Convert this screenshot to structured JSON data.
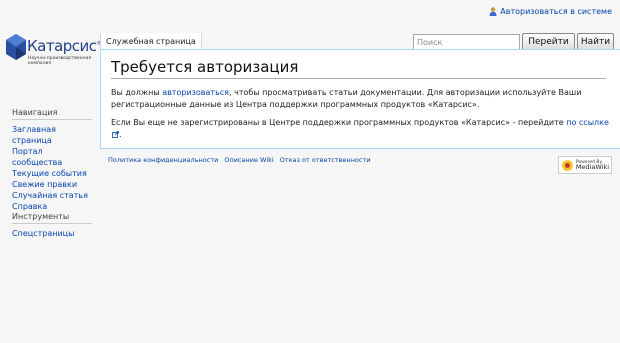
{
  "personal": {
    "login_link": "Авторизоваться в системе",
    "user_icon": "user-icon"
  },
  "logo": {
    "name": "Катарсис",
    "registered": "®",
    "tagline": "Научно-производственная компания"
  },
  "tabs": {
    "special_page": "Служебная страница"
  },
  "search": {
    "placeholder": "Поиск",
    "value": "",
    "go_label": "Перейти",
    "search_label": "Найти"
  },
  "content": {
    "title": "Требуется авторизация",
    "p1_before": "Вы должны ",
    "p1_link": "авторизоваться",
    "p1_after": ", чтобы просматривать статьи документации. Для авторизации используйте Ваши регистрационные данные из Центра поддержки программных продуктов «Катарсис».",
    "p2_before": "Если Вы еще не зарегистрированы в Центре поддержки программных продуктов «Катарсис» - перейдите ",
    "p2_link": "по ссылке",
    "p2_after": "."
  },
  "sidebar": {
    "navigation": {
      "heading": "Навигация",
      "items": [
        {
          "label": "Заглавная страница"
        },
        {
          "label": "Портал сообщества"
        },
        {
          "label": "Текущие события"
        },
        {
          "label": "Свежие правки"
        },
        {
          "label": "Случайная статья"
        },
        {
          "label": "Справка"
        }
      ]
    },
    "tools": {
      "heading": "Инструменты",
      "items": [
        {
          "label": "Спецстраницы"
        }
      ]
    }
  },
  "footer": {
    "links": [
      {
        "label": "Политика конфиденциальности"
      },
      {
        "label": "Описание Wiki"
      },
      {
        "label": "Отказ от ответственности"
      }
    ],
    "powered_small": "Powered By",
    "powered_big": "MediaWiki"
  },
  "colors": {
    "link": "#0645ad",
    "logo_blue": "#1f3f8c",
    "content_border": "#a7d7f9",
    "background": "#f6f6f6"
  }
}
